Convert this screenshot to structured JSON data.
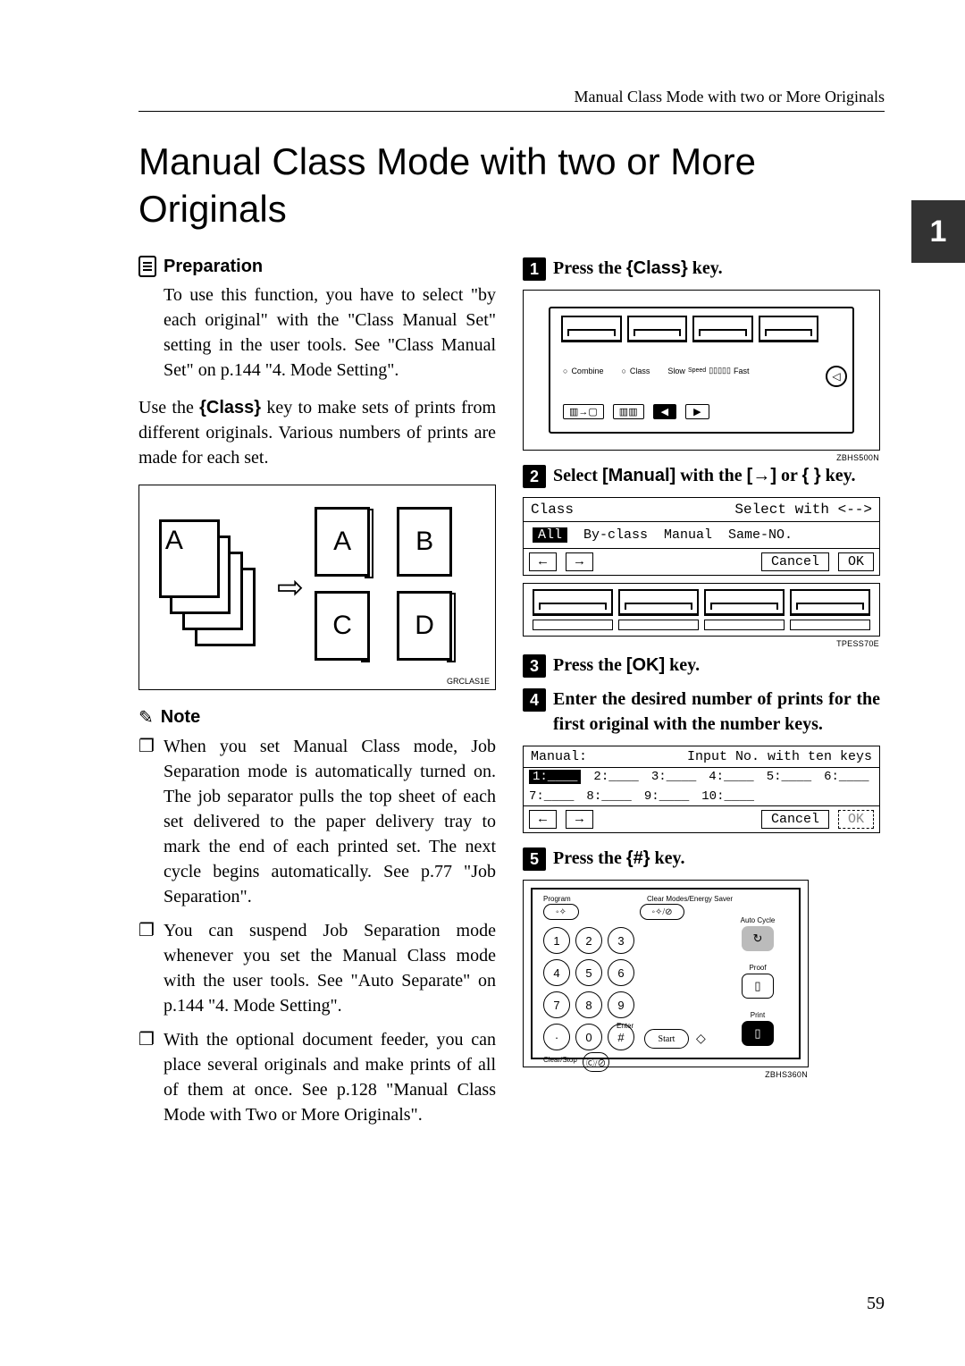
{
  "running_head": "Manual Class Mode with two or More Originals",
  "side_tab": "1",
  "title": "Manual Class Mode with two or More Originals",
  "left": {
    "preparation_label": "Preparation",
    "preparation_body": "To use this function, you have to select \"by each original\" with the \"Class Manual Set\" setting in the user tools. See \"Class Manual Set\" on p.144 \"4. Mode Setting\".",
    "use_para_before": "Use the ",
    "class_key": "{Class}",
    "use_para_after": " key to make sets of prints from different originals. Various numbers of prints are made for each set.",
    "diagram_letters": {
      "a": "A",
      "b": "B",
      "c": "C",
      "d": "D"
    },
    "diagram_code": "GRCLAS1E",
    "note_label": "Note",
    "notes": [
      "When you set Manual Class mode, Job Separation mode is automatically turned on. The job separator pulls the top sheet of each set delivered to the paper delivery tray to mark the end of each printed set. The next cycle begins automatically. See p.77 \"Job Separation\".",
      "You can suspend Job Separation mode whenever you set the Manual Class mode with the user tools. See \"Auto Separate\" on p.144 \"4. Mode Setting\".",
      "With the optional document feeder, you can place several originals and make prints of all of them at once. See p.128 \"Manual Class Mode with Two or More Originals\"."
    ]
  },
  "right": {
    "step1_before": "Press the ",
    "step1_key": "{Class}",
    "step1_after": " key.",
    "panel": {
      "combine": "Combine",
      "oclass": "Class",
      "speed": "Speed",
      "slow": "Slow",
      "fast": "Fast",
      "code": "ZBHS500N"
    },
    "step2_before": "Select ",
    "step2_manual": "[Manual]",
    "step2_mid": " with the ",
    "step2_arrow1": "[→]",
    "step2_or": " or ",
    "step2_arrow2": "{ }",
    "step2_after": " key.",
    "lcd1": {
      "title": "Class",
      "hint": "Select with <-->",
      "tabs": [
        "All",
        "By-class",
        "Manual",
        "Same-NO."
      ],
      "btns": [
        "←",
        "→",
        "Cancel",
        "OK"
      ]
    },
    "softstrip_code": "TPESS70E",
    "step3_before": "Press the ",
    "step3_key": "[OK]",
    "step3_after": " key.",
    "step4": "Enter the desired number of prints for the first original with the number keys.",
    "lcd2": {
      "title": "Manual:",
      "hint": "Input No. with ten keys",
      "cells": [
        "1:____",
        "2:____",
        "3:____",
        "4:____",
        "5:____",
        "6:____",
        "7:____",
        "8:____",
        "9:____",
        "10:____"
      ],
      "btns": [
        "←",
        "→",
        "Cancel",
        "OK"
      ]
    },
    "step5_before": "Press the ",
    "step5_key": "{#}",
    "step5_after": " key.",
    "keypad": {
      "program": "Program",
      "clearmodes": "Clear Modes/Energy Saver",
      "autocycle": "Auto Cycle",
      "proof": "Proof",
      "print": "Print",
      "enter": "Enter",
      "clearstop": "Clear/Stop",
      "start": "Start",
      "digits": [
        "1",
        "2",
        "3",
        "4",
        "5",
        "6",
        "7",
        "8",
        "9",
        "·",
        "0",
        "#"
      ],
      "code": "ZBHS360N"
    }
  },
  "page_number": "59"
}
